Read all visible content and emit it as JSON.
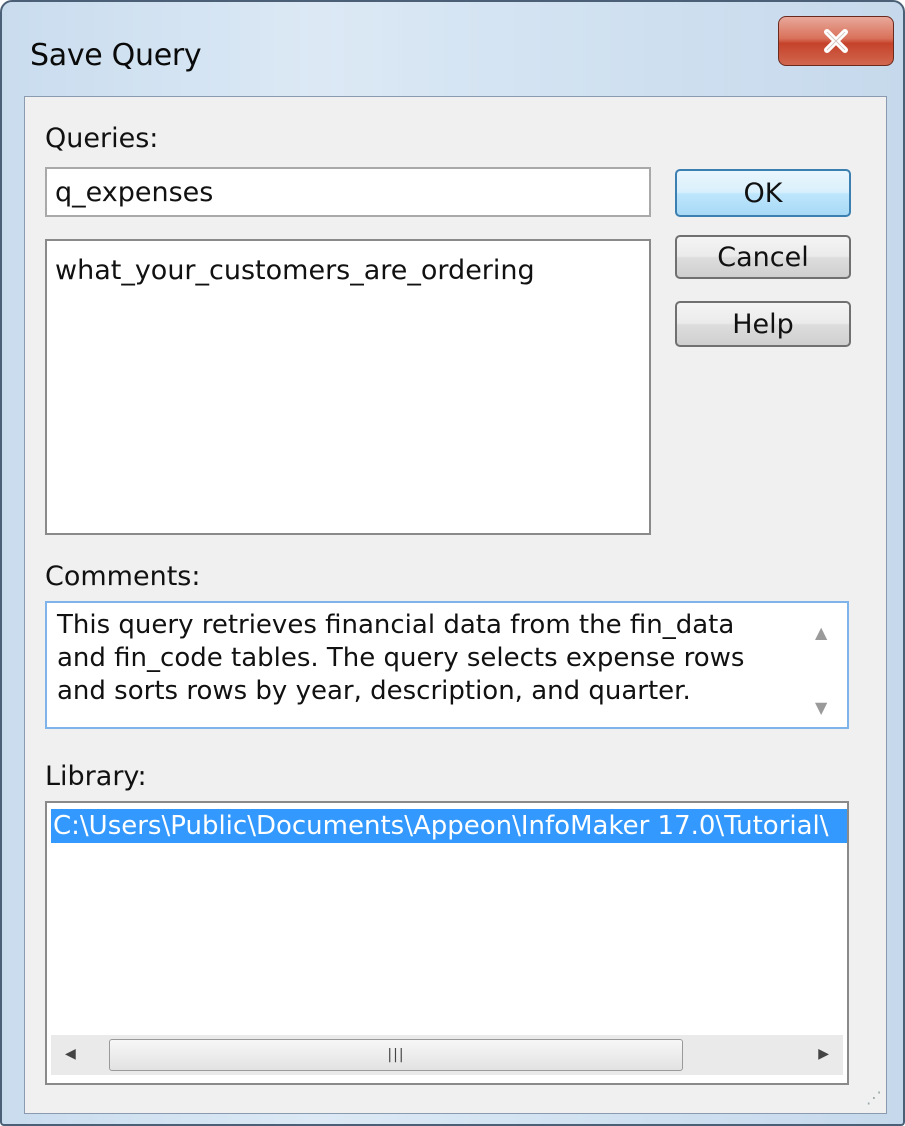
{
  "window": {
    "title": "Save Query"
  },
  "queries": {
    "label": "Queries:",
    "name_value": "q_expenses",
    "list_items": [
      "what_your_customers_are_ordering"
    ]
  },
  "buttons": {
    "ok": "OK",
    "cancel": "Cancel",
    "help": "Help"
  },
  "comments": {
    "label": "Comments:",
    "text": "This query retrieves financial data from the fin_data and fin_code tables. The query selects expense rows and sorts rows by year, description, and quarter."
  },
  "library": {
    "label": "Library:",
    "selected_item": "C:\\Users\\Public\\Documents\\Appeon\\InfoMaker 17.0\\Tutorial\\"
  },
  "icons": {
    "close": "close-icon",
    "scroll_up": "arrow-up-icon",
    "scroll_down": "arrow-down-icon",
    "scroll_left": "arrow-left-icon",
    "scroll_right": "arrow-right-icon",
    "resize_grip": "resize-grip-icon"
  },
  "colors": {
    "selection": "#3399ff",
    "default_button_border": "#3c7fb1",
    "close_button": "#c5422a"
  }
}
